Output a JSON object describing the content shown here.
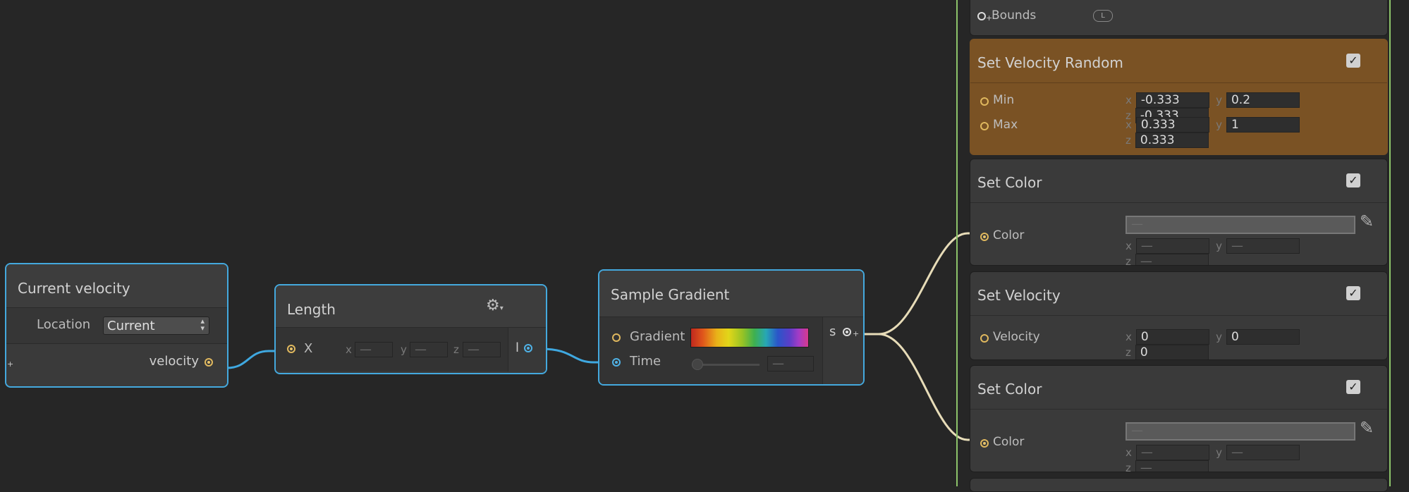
{
  "nodes": {
    "current_velocity": {
      "title": "Current velocity",
      "location_label": "Location",
      "location_value": "Current",
      "output_label": "velocity"
    },
    "length": {
      "title": "Length",
      "input_label": "X",
      "x_label": "x",
      "y_label": "y",
      "z_label": "z",
      "x_value": "—",
      "y_value": "—",
      "z_value": "—",
      "output_label": "l"
    },
    "sample_gradient": {
      "title": "Sample Gradient",
      "gradient_label": "Gradient",
      "time_label": "Time",
      "time_value": "—",
      "output_label": "s"
    }
  },
  "panel": {
    "bounds_label": "Bounds",
    "bounds_badge": "L",
    "blocks": [
      {
        "title": "Set Velocity Random",
        "checked": "✓",
        "rows": [
          {
            "label": "Min",
            "x": "-0.333",
            "y": "0.2",
            "z": "-0.333"
          },
          {
            "label": "Max",
            "x": "0.333",
            "y": "1",
            "z": "0.333"
          }
        ]
      },
      {
        "title": "Set Color",
        "checked": "✓",
        "color_label": "Color",
        "color_value": "—",
        "x": "—",
        "y": "—",
        "z": "—"
      },
      {
        "title": "Set Velocity",
        "checked": "✓",
        "velocity_label": "Velocity",
        "x": "0",
        "y": "0",
        "z": "0"
      },
      {
        "title": "Set Color",
        "checked": "✓",
        "color_label": "Color",
        "color_value": "—",
        "x": "—",
        "y": "—",
        "z": "—"
      }
    ],
    "axis_labels": {
      "x": "x",
      "y": "y",
      "z": "z"
    }
  },
  "colors": {
    "background": "#262626",
    "node_border": "#44a9de",
    "wire_blue": "#3fa8e0",
    "wire_cream": "#e7dcb8",
    "highlight_block": "#7a5224",
    "panel_border": "#8cc36a"
  },
  "icons": [
    "gear-icon",
    "eyedropper-icon",
    "checkbox-icon",
    "dropdown-arrows-icon",
    "port-icon"
  ]
}
